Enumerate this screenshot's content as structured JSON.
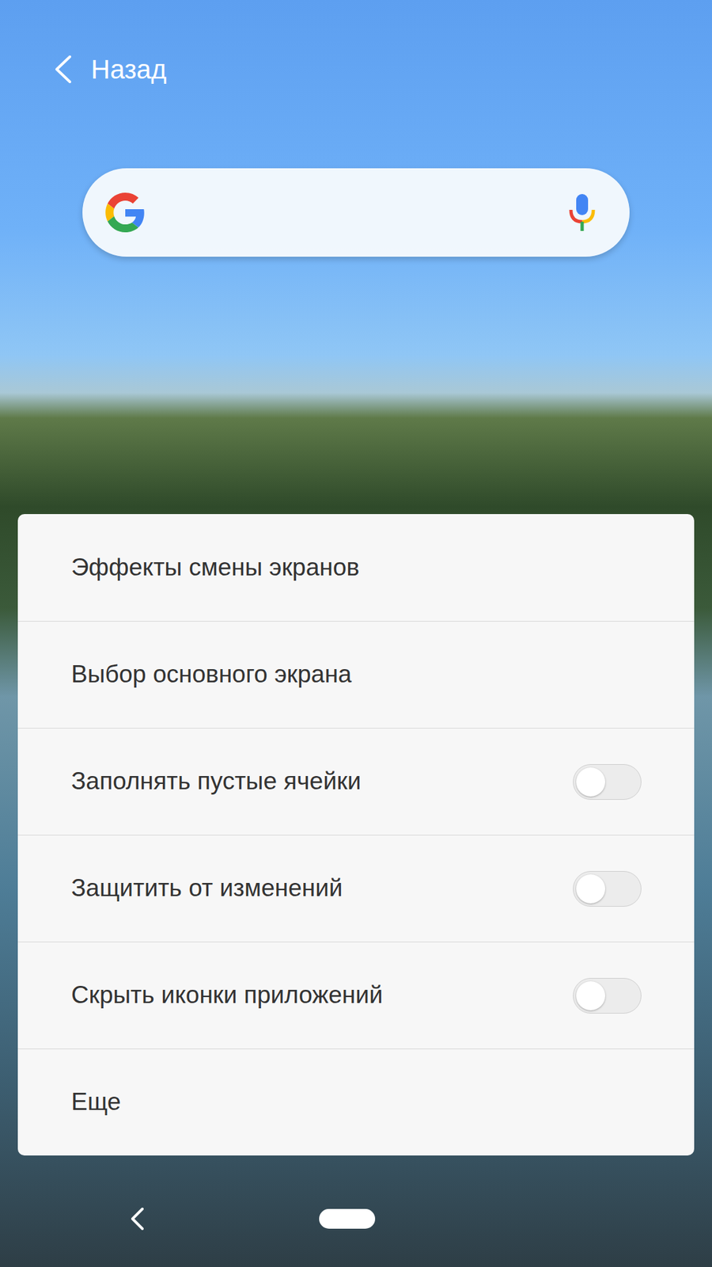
{
  "header": {
    "back_label": "Назад"
  },
  "search": {
    "placeholder": ""
  },
  "menu": [
    {
      "label": "Эффекты смены экранов",
      "kind": "link"
    },
    {
      "label": "Выбор основного экрана",
      "kind": "link"
    },
    {
      "label": "Заполнять пустые ячейки",
      "kind": "toggle",
      "on": false
    },
    {
      "label": "Защитить от изменений",
      "kind": "toggle",
      "on": false
    },
    {
      "label": "Скрыть иконки приложений",
      "kind": "toggle",
      "on": false
    },
    {
      "label": "Еще",
      "kind": "link"
    }
  ]
}
